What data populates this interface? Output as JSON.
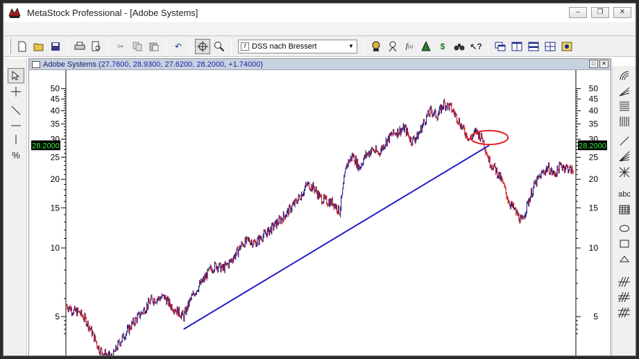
{
  "window": {
    "title": "MetaStock Professional - [Adobe Systems]",
    "buttons": [
      "–",
      "❐",
      "✕"
    ]
  },
  "toolbar": {
    "expert_select": "DSS nach Bressert",
    "icons": [
      "new-icon",
      "open-icon",
      "save-icon",
      "print-icon",
      "print-preview-icon",
      "cut-icon",
      "copy-icon",
      "paste-icon",
      "undo-icon",
      "crosshair-icon",
      "zoom-icon",
      "expert-advisor-icon",
      "explorer-icon",
      "indicator-builder-icon",
      "system-tester-icon",
      "dollar-icon",
      "binoculars-icon",
      "help-icon",
      "window-cascade-icon",
      "tile-vertical-icon",
      "tile-horizontal-icon",
      "tile-grid-icon",
      "arrange-icon"
    ]
  },
  "chart": {
    "security": "Adobe Systems",
    "ohlc_text": "(27.7600, 28.9300, 27.6200, 28.2000, +1.74000)",
    "last_price_label": "28.2000",
    "colors": {
      "up_bar": "#1c1c8c",
      "down_bar": "#cc1a1a",
      "trendline": "#1f1fcc",
      "circle": "#e02020",
      "price_label_bg": "#000000",
      "price_label_fg": "#33ff33"
    }
  },
  "chart_data": {
    "type": "line",
    "title": "",
    "scale": "log",
    "ylim": [
      3.2,
      60
    ],
    "y_ticks": [
      50,
      45,
      40,
      35,
      30,
      25,
      20,
      15,
      10,
      5
    ],
    "series": [
      {
        "values": [
          5.6,
          5.3,
          5.2,
          4.8,
          4.2,
          3.6,
          3.4,
          3.3,
          3.8,
          4.2,
          4.6,
          5.0,
          5.4,
          5.9,
          6.0,
          6.1,
          5.6,
          5.3,
          5.0,
          5.9,
          6.6,
          7.2,
          8.0,
          8.4,
          8.1,
          8.6,
          9.4,
          10.4,
          10.8,
          10.5,
          11.2,
          11.8,
          12.6,
          13.4,
          14.4,
          15.6,
          17.0,
          19.0,
          18.4,
          16.6,
          16.0,
          15.8,
          14.4,
          23.0,
          25.5,
          22.5,
          25.5,
          27.0,
          26.0,
          29.0,
          31.5,
          32.5,
          33.5,
          29.5,
          31.0,
          36.0,
          40.0,
          38.0,
          43.0,
          41.5,
          37.5,
          33.0,
          30.0,
          32.5,
          30.0,
          24.0,
          22.0,
          19.5,
          16.0,
          14.5,
          13.0,
          16.0,
          19.0,
          21.0,
          22.5,
          21.0,
          23.0,
          22.5,
          21.5
        ]
      }
    ],
    "annotations": [
      {
        "type": "trendline",
        "from": [
          18,
          4.4
        ],
        "to": [
          65,
          28.2
        ]
      },
      {
        "type": "ellipse",
        "center": [
          65,
          30.5
        ]
      }
    ]
  }
}
